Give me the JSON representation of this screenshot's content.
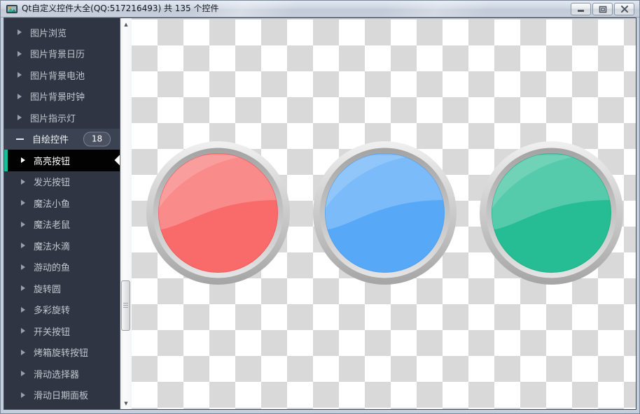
{
  "window": {
    "title": "Qt自定义控件大全(QQ:517216493) 共 135 个控件"
  },
  "sidebar": {
    "accent_color": "#1abc9c",
    "items": [
      {
        "name": "picture-browser",
        "label": "图片浏览",
        "level": "parent"
      },
      {
        "name": "picture-bg-calendar",
        "label": "图片背景日历",
        "level": "parent"
      },
      {
        "name": "picture-bg-battery",
        "label": "图片背景电池",
        "level": "parent"
      },
      {
        "name": "picture-bg-clock",
        "label": "图片背景时钟",
        "level": "parent"
      },
      {
        "name": "picture-indicator",
        "label": "图片指示灯",
        "level": "parent"
      },
      {
        "name": "self-drawn-controls",
        "label": "自绘控件",
        "level": "parent",
        "expanded": true,
        "badge": "18"
      },
      {
        "name": "highlight-button",
        "label": "高亮按钮",
        "level": "child",
        "selected": true
      },
      {
        "name": "glow-button",
        "label": "发光按钮",
        "level": "child"
      },
      {
        "name": "magic-fish",
        "label": "魔法小鱼",
        "level": "child"
      },
      {
        "name": "magic-mouse",
        "label": "魔法老鼠",
        "level": "child"
      },
      {
        "name": "magic-water-drop",
        "label": "魔法水滴",
        "level": "child"
      },
      {
        "name": "swimming-fish",
        "label": "游动的鱼",
        "level": "child"
      },
      {
        "name": "rotating-circle",
        "label": "旋转圆",
        "level": "child"
      },
      {
        "name": "colorful-rotation",
        "label": "多彩旋转",
        "level": "child"
      },
      {
        "name": "switch-button",
        "label": "开关按钮",
        "level": "child"
      },
      {
        "name": "oven-knob-button",
        "label": "烤箱旋转按钮",
        "level": "child"
      },
      {
        "name": "slide-selector",
        "label": "滑动选择器",
        "level": "child"
      },
      {
        "name": "slide-date-panel",
        "label": "滑动日期面板",
        "level": "child"
      }
    ]
  },
  "content": {
    "checker_gray": "#d9d9d9",
    "buttons": [
      {
        "name": "highlight-button-red",
        "color": "#f96b6b",
        "edge": "#ef5a5a"
      },
      {
        "name": "highlight-button-blue",
        "color": "#58a8f8",
        "edge": "#4d9ff0"
      },
      {
        "name": "highlight-button-green",
        "color": "#26bd94",
        "edge": "#1db188"
      }
    ]
  }
}
